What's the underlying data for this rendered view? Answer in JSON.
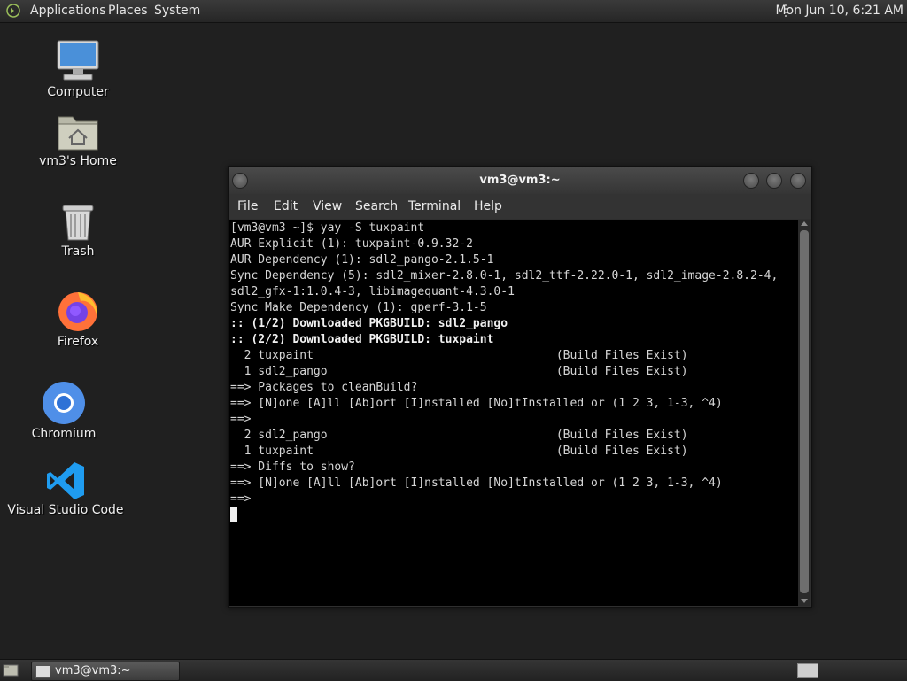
{
  "top_panel": {
    "menus": [
      "Applications",
      "Places",
      "System"
    ],
    "clock": "Mon Jun 10,  6:21 AM"
  },
  "desktop": {
    "icons": [
      {
        "label": "Computer",
        "icon": "computer-icon"
      },
      {
        "label": "vm3's Home",
        "icon": "home-folder-icon"
      },
      {
        "label": "Trash",
        "icon": "trash-icon"
      },
      {
        "label": "Firefox",
        "icon": "firefox-icon"
      },
      {
        "label": "Chromium",
        "icon": "chromium-icon"
      },
      {
        "label": "Visual Studio Code",
        "icon": "vscode-icon"
      }
    ]
  },
  "terminal": {
    "title": "vm3@vm3:~",
    "menu": [
      "File",
      "Edit",
      "View",
      "Search",
      "Terminal",
      "Help"
    ],
    "lines": [
      {
        "text": "[vm3@vm3 ~]$ yay -S tuxpaint",
        "bold": false
      },
      {
        "text": "AUR Explicit (1): tuxpaint-0.9.32-2",
        "bold": false
      },
      {
        "text": "AUR Dependency (1): sdl2_pango-2.1.5-1",
        "bold": false
      },
      {
        "text": "Sync Dependency (5): sdl2_mixer-2.8.0-1, sdl2_ttf-2.22.0-1, sdl2_image-2.8.2-4,",
        "bold": false
      },
      {
        "text": "sdl2_gfx-1:1.0.4-3, libimagequant-4.3.0-1",
        "bold": false
      },
      {
        "text": "Sync Make Dependency (1): gperf-3.1-5",
        "bold": false
      },
      {
        "text": ":: (1/2) Downloaded PKGBUILD: sdl2_pango",
        "bold": true
      },
      {
        "text": ":: (2/2) Downloaded PKGBUILD: tuxpaint",
        "bold": true
      },
      {
        "text": "  2 tuxpaint                                   (Build Files Exist)",
        "bold": false
      },
      {
        "text": "  1 sdl2_pango                                 (Build Files Exist)",
        "bold": false
      },
      {
        "text": "==> Packages to cleanBuild?",
        "bold": false
      },
      {
        "text": "==> [N]one [A]ll [Ab]ort [I]nstalled [No]tInstalled or (1 2 3, 1-3, ^4)",
        "bold": false
      },
      {
        "text": "==>",
        "bold": false
      },
      {
        "text": "  2 sdl2_pango                                 (Build Files Exist)",
        "bold": false
      },
      {
        "text": "  1 tuxpaint                                   (Build Files Exist)",
        "bold": false
      },
      {
        "text": "==> Diffs to show?",
        "bold": false
      },
      {
        "text": "==> [N]one [A]ll [Ab]ort [I]nstalled [No]tInstalled or (1 2 3, 1-3, ^4)",
        "bold": false
      },
      {
        "text": "==>",
        "bold": false
      }
    ]
  },
  "taskbar": {
    "window_button": "vm3@vm3:~"
  }
}
